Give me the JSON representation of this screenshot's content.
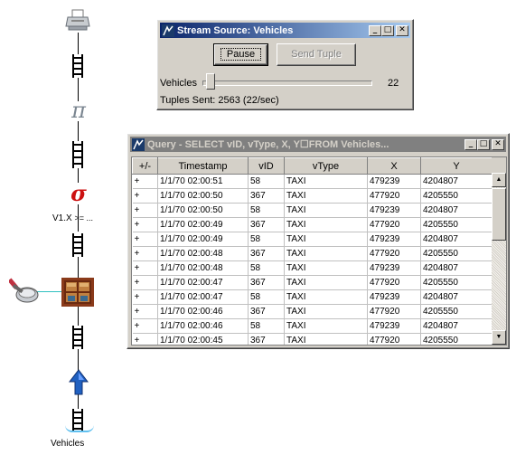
{
  "pipeline": {
    "select_label": "V1.X",
    "select_op": ">= ...",
    "source_label": "Vehicles"
  },
  "source_window": {
    "title": "Stream Source: Vehicles",
    "pause_label": "Pause",
    "send_tuple_label": "Send Tuple",
    "slider_label": "Vehicles",
    "slider_value": "22",
    "slider_fraction": 0.02,
    "tuples_sent": "Tuples Sent: 2563 (22/sec)"
  },
  "query_window": {
    "title": "Query - SELECT vID, vType, X, Y☐FROM Vehicles...",
    "columns": [
      "+/-",
      "Timestamp",
      "vID",
      "vType",
      "X",
      "Y"
    ],
    "rows": [
      [
        "+",
        "1/1/70 02:00:51",
        "58",
        "TAXI",
        "479239",
        "4204807"
      ],
      [
        "+",
        "1/1/70 02:00:50",
        "367",
        "TAXI",
        "477920",
        "4205550"
      ],
      [
        "+",
        "1/1/70 02:00:50",
        "58",
        "TAXI",
        "479239",
        "4204807"
      ],
      [
        "+",
        "1/1/70 02:00:49",
        "367",
        "TAXI",
        "477920",
        "4205550"
      ],
      [
        "+",
        "1/1/70 02:00:49",
        "58",
        "TAXI",
        "479239",
        "4204807"
      ],
      [
        "+",
        "1/1/70 02:00:48",
        "367",
        "TAXI",
        "477920",
        "4205550"
      ],
      [
        "+",
        "1/1/70 02:00:48",
        "58",
        "TAXI",
        "479239",
        "4204807"
      ],
      [
        "+",
        "1/1/70 02:00:47",
        "367",
        "TAXI",
        "477920",
        "4205550"
      ],
      [
        "+",
        "1/1/70 02:00:47",
        "58",
        "TAXI",
        "479239",
        "4204807"
      ],
      [
        "+",
        "1/1/70 02:00:46",
        "367",
        "TAXI",
        "477920",
        "4205550"
      ],
      [
        "+",
        "1/1/70 02:00:46",
        "58",
        "TAXI",
        "479239",
        "4204807"
      ],
      [
        "+",
        "1/1/70 02:00:45",
        "367",
        "TAXI",
        "477920",
        "4205550"
      ]
    ]
  },
  "colors": {
    "title_active": "#0a246a",
    "title_inactive": "#808080",
    "sigma": "#cc1111",
    "pi": "#7a8590",
    "arrow": "#2060c0"
  },
  "icons": {
    "output": "printer-icon",
    "project": "pi-icon",
    "select": "sigma-icon",
    "join": "join-window-icon",
    "source": "up-arrow-icon",
    "table_source": "magnifier-icon",
    "queue": "queue-ladder-icon"
  }
}
